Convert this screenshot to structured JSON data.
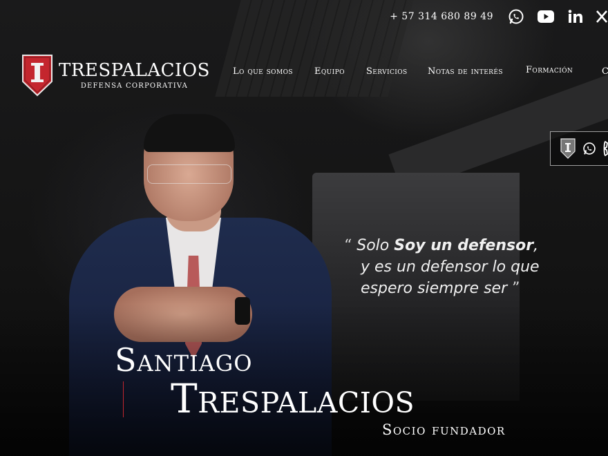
{
  "topbar": {
    "phone": "+ 57  314 680 89 49",
    "social_icons": [
      "whatsapp-icon",
      "youtube-icon",
      "linkedin-icon",
      "x-icon"
    ]
  },
  "logo": {
    "name": "TRESPALACIOS",
    "subtitle": "DEFENSA CORPORATIVA",
    "colors": {
      "shield": "#c4262e",
      "shield_border": "#e8e8e8"
    }
  },
  "nav": {
    "items": [
      {
        "label": "Lo que somos"
      },
      {
        "label": "Equipo"
      },
      {
        "label": "Servicios"
      },
      {
        "label": "Notas de interés"
      },
      {
        "label": "Formación"
      },
      {
        "label": "C"
      }
    ]
  },
  "floating_contact": {
    "icons": [
      "trespalacios-shield-icon",
      "whatsapp-icon",
      "phone-icon"
    ]
  },
  "hero": {
    "quote": {
      "open_mark": "“",
      "line1_pre": "Solo ",
      "line1_bold": "Soy un defensor",
      "line1_post": ",",
      "line2": "y es un defensor lo que",
      "line3": "espero siempre ser",
      "close_mark": "”"
    },
    "first_name": "Santiago",
    "last_name": "Trespalacios",
    "role": "Socio fundador",
    "accent_color": "#c4262e"
  }
}
